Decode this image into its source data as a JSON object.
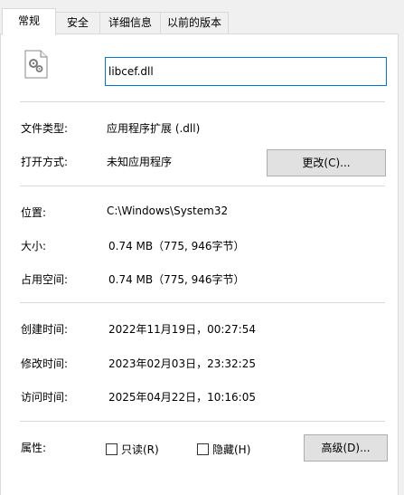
{
  "tabs": [
    "常规",
    "安全",
    "详细信息",
    "以前的版本"
  ],
  "file_name": "libcef.dll",
  "file_type": {
    "label": "文件类型:",
    "value": "应用程序扩展 (.dll)"
  },
  "opens_with": {
    "label": "打开方式:",
    "value": "未知应用程序",
    "button": "更改(C)..."
  },
  "location": {
    "label": "位置:",
    "value": "C:\\Windows\\System32"
  },
  "size": {
    "label": "大小:",
    "value": "0.74 MB（775, 946字节）"
  },
  "size_on_disk": {
    "label": "占用空间:",
    "value": "0.74 MB（775, 946字节）"
  },
  "created": {
    "label": "创建时间:",
    "value": "2022年11月19日，00:27:54"
  },
  "modified": {
    "label": "修改时间:",
    "value": "2023年02月03日，23:32:25"
  },
  "accessed": {
    "label": "访问时间:",
    "value": "2025年04月22日，10:16:05"
  },
  "attributes": {
    "label": "属性:",
    "readonly": "只读(R)",
    "hidden": "隐藏(H)",
    "advanced": "高级(D)..."
  }
}
